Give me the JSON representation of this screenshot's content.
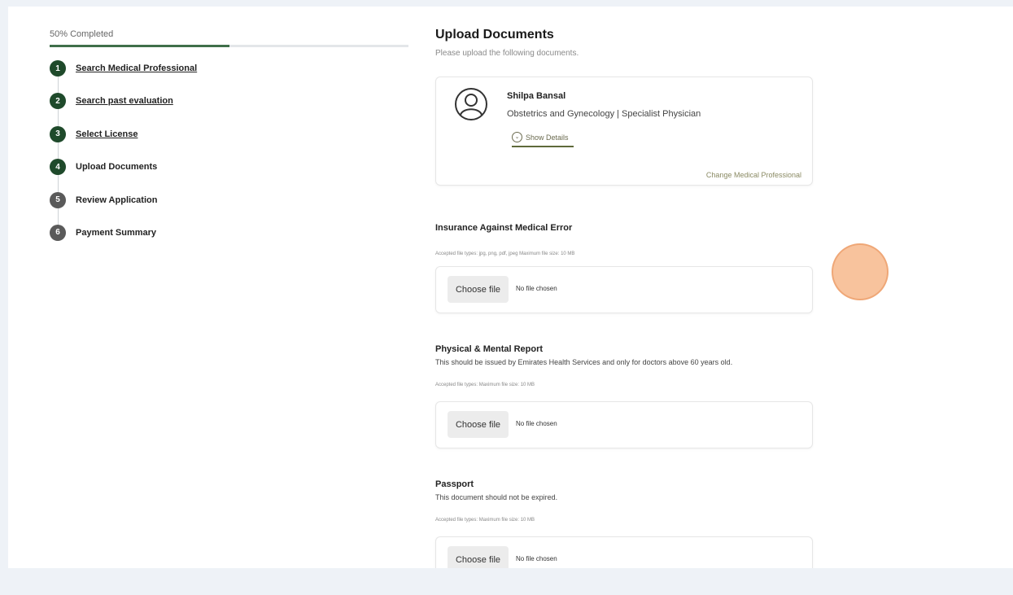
{
  "progress": {
    "label": "50% Completed",
    "fraction": 0.5
  },
  "steps": [
    {
      "num": "1",
      "label": "Search Medical Professional",
      "state": "done"
    },
    {
      "num": "2",
      "label": "Search past evaluation",
      "state": "done"
    },
    {
      "num": "3",
      "label": "Select License",
      "state": "done"
    },
    {
      "num": "4",
      "label": "Upload Documents",
      "state": "current"
    },
    {
      "num": "5",
      "label": "Review Application",
      "state": "pending"
    },
    {
      "num": "6",
      "label": "Payment Summary",
      "state": "pending"
    }
  ],
  "page": {
    "title": "Upload Documents",
    "subtitle": "Please upload the following documents."
  },
  "professional": {
    "name": "Shilpa Bansal",
    "role": "Obstetrics and Gynecology | Specialist Physician",
    "show_details": "Show Details",
    "change_link": "Change Medical Professional",
    "avatar_icon": "user-circle-icon"
  },
  "documents": [
    {
      "title": "Insurance Against Medical Error",
      "description": "",
      "hint": "Accepted file types: jpg, png, pdf, jpeg Maximum file size: 10 MB",
      "button": "Choose file",
      "status": "No file chosen"
    },
    {
      "title": "Physical & Mental Report",
      "description": "This should be issued by Emirates Health Services and only for doctors above 60 years old.",
      "hint": "Accepted file types: Maximum file size: 10 MB",
      "button": "Choose file",
      "status": "No file chosen"
    },
    {
      "title": "Passport",
      "description": "This document should not be expired.",
      "hint": "Accepted file types: Maximum file size: 10 MB",
      "button": "Choose file",
      "status": "No file chosen"
    }
  ],
  "colors": {
    "step_done": "#1f4a2b",
    "step_pending": "#5a5a5a",
    "progress": "#3f6f4a",
    "cursor_highlight": "#f6b282"
  }
}
